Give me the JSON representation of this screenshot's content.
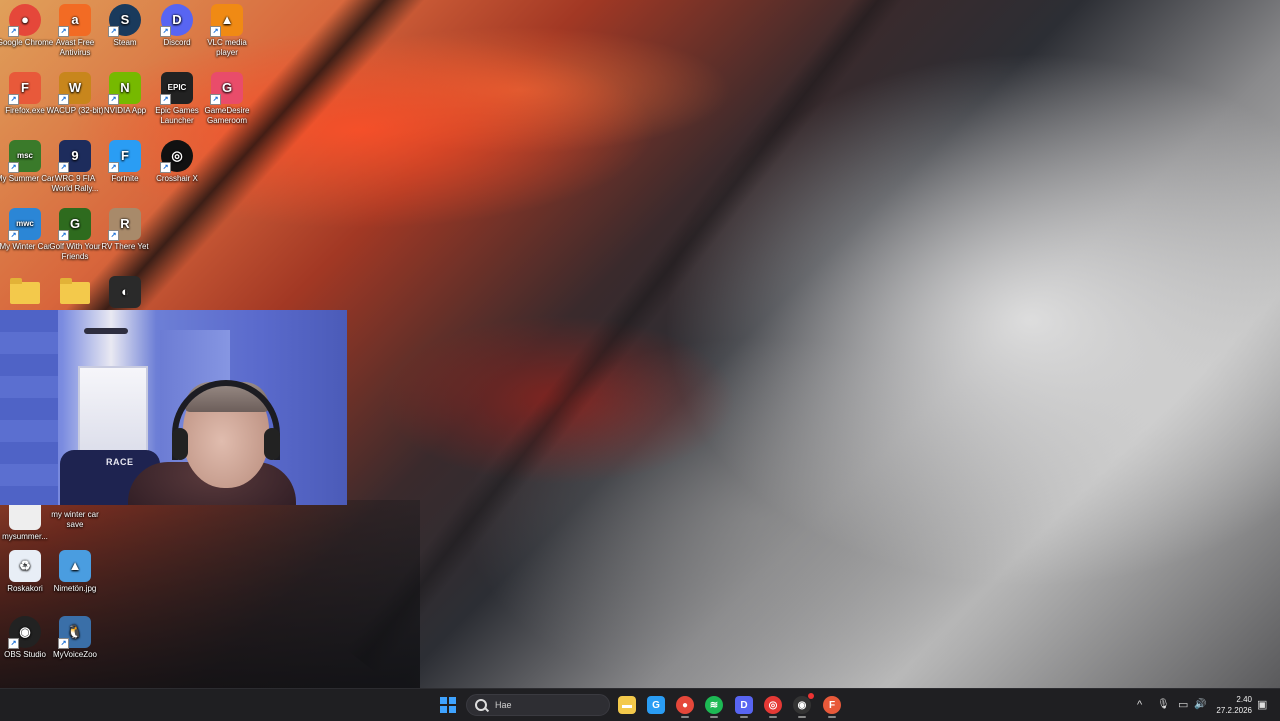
{
  "desktop": {
    "icons": [
      {
        "id": "chrome",
        "label": "Google Chrome",
        "glyph": "●",
        "color": "#e5473a",
        "shortcut": true
      },
      {
        "id": "avast",
        "label": "Avast Free Antivirus",
        "glyph": "a",
        "color": "#f26b24",
        "shortcut": true
      },
      {
        "id": "steam",
        "label": "Steam",
        "glyph": "S",
        "color": "#1a3a5c",
        "shortcut": true
      },
      {
        "id": "discord",
        "label": "Discord",
        "glyph": "D",
        "color": "#5865f2",
        "shortcut": true
      },
      {
        "id": "vlc",
        "label": "VLC media player",
        "glyph": "▲",
        "color": "#f08a14",
        "shortcut": true
      },
      {
        "id": "firefox",
        "label": "Firefox.exe",
        "glyph": "F",
        "color": "#e8593a",
        "shortcut": true
      },
      {
        "id": "wacup",
        "label": "WACUP (32-bit)",
        "glyph": "W",
        "color": "#c8861c",
        "shortcut": true
      },
      {
        "id": "nvidia",
        "label": "NVIDIA App",
        "glyph": "N",
        "color": "#76b900",
        "shortcut": true
      },
      {
        "id": "epic",
        "label": "Epic Games Launcher",
        "glyph": "EPIC",
        "color": "#222",
        "shortcut": true
      },
      {
        "id": "gamedesire",
        "label": "GameDesire Gameroom",
        "glyph": "G",
        "color": "#e94c6a",
        "shortcut": true
      },
      {
        "id": "mysummercar",
        "label": "My Summer Car",
        "glyph": "msc",
        "color": "#3a7a2a",
        "shortcut": true
      },
      {
        "id": "wrc9",
        "label": "WRC 9 FIA World Rally...",
        "glyph": "9",
        "color": "#1d2c5c",
        "shortcut": true
      },
      {
        "id": "fortnite",
        "label": "Fortnite",
        "glyph": "F",
        "color": "#2a9df4",
        "shortcut": true
      },
      {
        "id": "crosshair",
        "label": "Crosshair X",
        "glyph": "◎",
        "color": "#111",
        "shortcut": true
      },
      {
        "id": "mywintercar",
        "label": "My Winter Car",
        "glyph": "mwc",
        "color": "#2b86d6",
        "shortcut": true
      },
      {
        "id": "golfwithfriends",
        "label": "Golf With Your Friends",
        "glyph": "G",
        "color": "#2e6b1e",
        "shortcut": true
      },
      {
        "id": "rvthereyet",
        "label": "RV There Yet",
        "glyph": "R",
        "color": "#a88a6a",
        "shortcut": true
      },
      {
        "id": "folder1",
        "label": "",
        "glyph": "",
        "color": "",
        "shortcut": false
      },
      {
        "id": "folder2",
        "label": "",
        "glyph": "",
        "color": "",
        "shortcut": false
      },
      {
        "id": "game-unknown",
        "label": "",
        "glyph": "◐",
        "color": "#2a2a2a",
        "shortcut": false
      },
      {
        "id": "mysummercar-save",
        "label": "mysummer...",
        "glyph": "",
        "color": "#eee",
        "shortcut": false
      },
      {
        "id": "mywintercar-save",
        "label": "my winter car save",
        "glyph": "",
        "color": "",
        "shortcut": false
      },
      {
        "id": "recycle-bin",
        "label": "Roskakori",
        "glyph": "♻",
        "color": "#e8eef6",
        "shortcut": false
      },
      {
        "id": "nimetonjpg",
        "label": "Nimetön.jpg",
        "glyph": "▲",
        "color": "#4a9de0",
        "shortcut": false
      },
      {
        "id": "obs",
        "label": "OBS Studio",
        "glyph": "◉",
        "color": "#222",
        "shortcut": true
      },
      {
        "id": "myvoicezoo",
        "label": "MyVoiceZoo",
        "glyph": "🐧",
        "color": "#3a6fa8",
        "shortcut": true
      }
    ]
  },
  "webcam": {
    "chair_label": "RACE"
  },
  "taskbar": {
    "search_placeholder": "Hae",
    "apps": [
      {
        "id": "file-explorer",
        "glyph": "▬",
        "color": "#f3c94b"
      },
      {
        "id": "edge-like",
        "glyph": "G",
        "color": "#2a9df4"
      },
      {
        "id": "chrome",
        "glyph": "●",
        "color": "#e5473a"
      },
      {
        "id": "spotify",
        "glyph": "≋",
        "color": "#1db954"
      },
      {
        "id": "discord",
        "glyph": "D",
        "color": "#5865f2"
      },
      {
        "id": "app-circle",
        "glyph": "◎",
        "color": "#e53935"
      },
      {
        "id": "obs",
        "glyph": "◉",
        "color": "#333"
      },
      {
        "id": "firefox",
        "glyph": "F",
        "color": "#e8593a"
      }
    ],
    "tray": {
      "chevron": "^",
      "mic": "🎙",
      "network": "▭",
      "volume": "🔊"
    },
    "clock": {
      "time": "2.40",
      "date": "27.2.2026"
    }
  }
}
